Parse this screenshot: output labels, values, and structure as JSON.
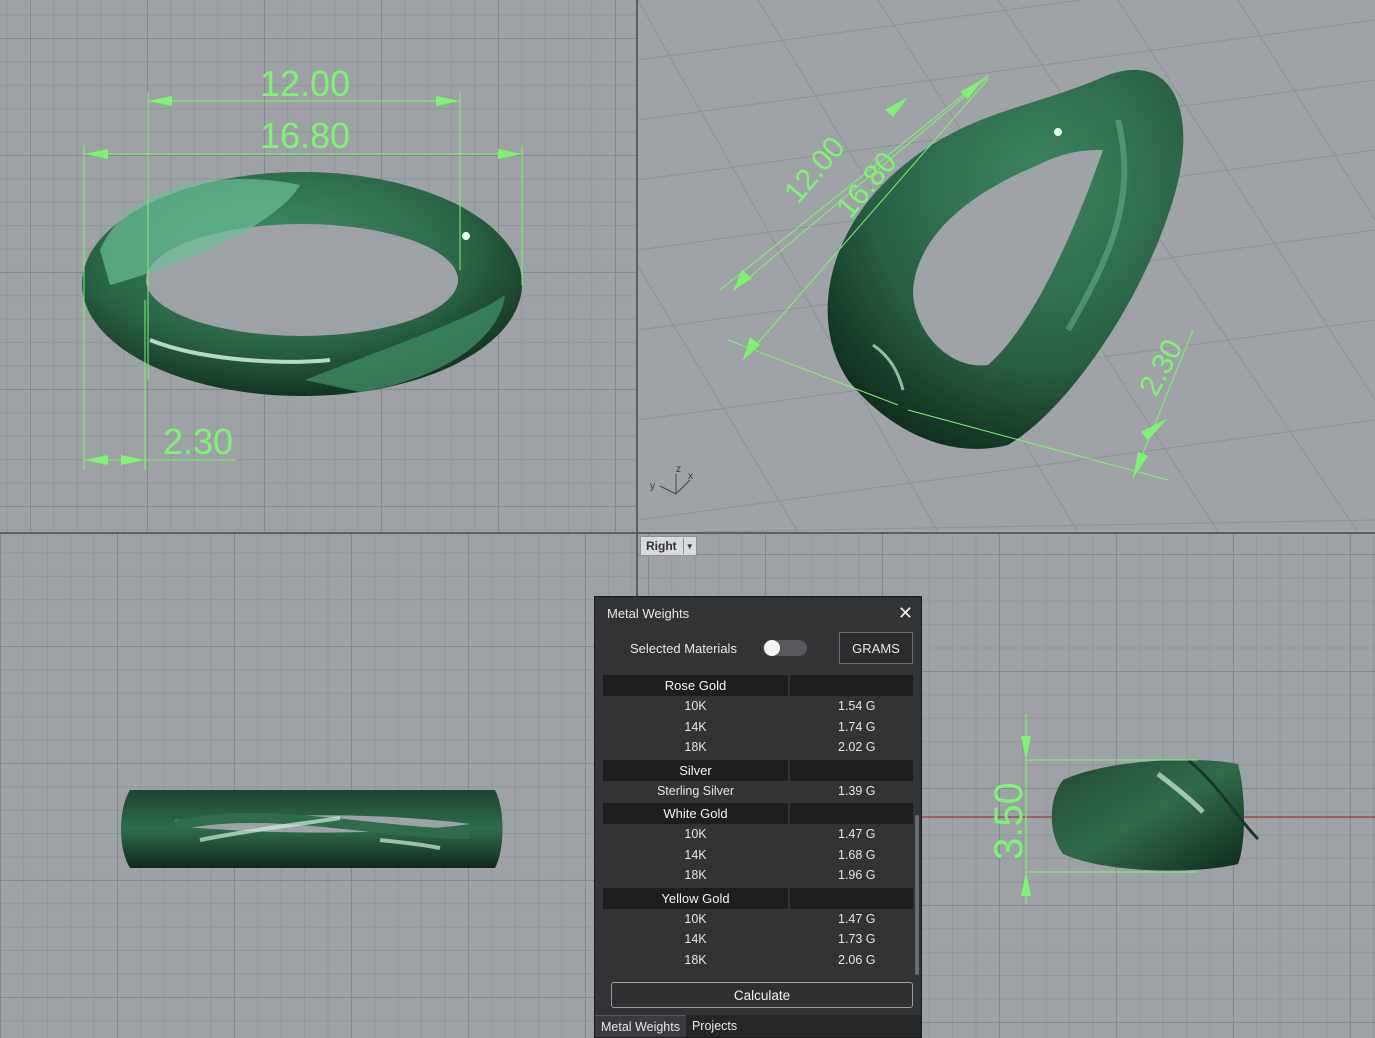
{
  "viewports": {
    "top_left": {
      "dimensions": [
        "12.00",
        "16.80",
        "2.30"
      ]
    },
    "top_right": {
      "dimensions": [
        "12.00",
        "16.80",
        "2.30"
      ],
      "axis_labels": [
        "z",
        "y",
        "x"
      ]
    },
    "bottom_right": {
      "label": "Right",
      "dimensions": [
        "3.50"
      ]
    }
  },
  "panel": {
    "title": "Metal Weights",
    "selected_materials_label": "Selected Materials",
    "units_button": "GRAMS",
    "groups": [
      {
        "name": "Rose Gold",
        "items": [
          {
            "karat": "10K",
            "weight": "1.54 G"
          },
          {
            "karat": "14K",
            "weight": "1.74 G"
          },
          {
            "karat": "18K",
            "weight": "2.02 G"
          }
        ]
      },
      {
        "name": "Silver",
        "items": [
          {
            "karat": "Sterling Silver",
            "weight": "1.39 G"
          }
        ]
      },
      {
        "name": "White Gold",
        "items": [
          {
            "karat": "10K",
            "weight": "1.47 G"
          },
          {
            "karat": "14K",
            "weight": "1.68 G"
          },
          {
            "karat": "18K",
            "weight": "1.96 G"
          }
        ]
      },
      {
        "name": "Yellow Gold",
        "items": [
          {
            "karat": "10K",
            "weight": "1.47 G"
          },
          {
            "karat": "14K",
            "weight": "1.73 G"
          },
          {
            "karat": "18K",
            "weight": "2.06 G"
          }
        ]
      }
    ],
    "calculate_label": "Calculate",
    "tabs": [
      "Metal Weights",
      "Projects"
    ]
  },
  "colors": {
    "ring": "#2f6b4b",
    "dimension": "#7cf56e",
    "panel_bg": "#323335"
  }
}
